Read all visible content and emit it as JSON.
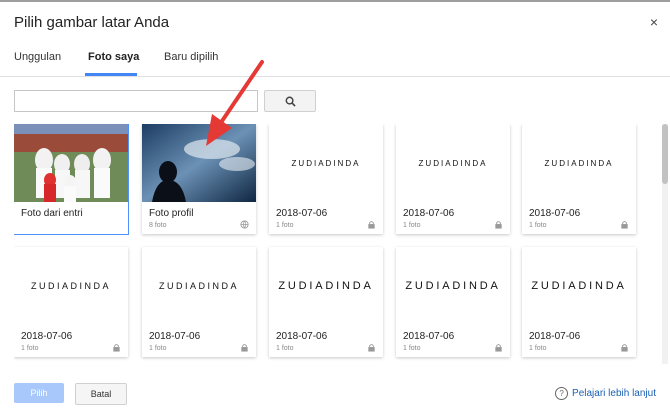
{
  "dialog": {
    "title": "Pilih gambar latar Anda",
    "close_glyph": "×",
    "tabs": [
      {
        "label": "Unggulan",
        "active": false
      },
      {
        "label": "Foto saya",
        "active": true
      },
      {
        "label": "Baru dipilih",
        "active": false
      }
    ],
    "search": {
      "placeholder": "",
      "value": "",
      "button_icon": "search-icon"
    },
    "cards": [
      {
        "title": "Foto dari entri",
        "meta": "",
        "icon": "",
        "image": "group-photo",
        "selected": true
      },
      {
        "title": "Foto profil",
        "meta": "8 foto",
        "icon": "globe-icon",
        "image": "silhouette-sky"
      },
      {
        "title": "2018-07-06",
        "meta": "1 foto",
        "icon": "lock-icon",
        "image": "logo",
        "logo_text": "ZUDIADINDA"
      },
      {
        "title": "2018-07-06",
        "meta": "1 foto",
        "icon": "lock-icon",
        "image": "logo",
        "logo_text": "ZUDIADINDA"
      },
      {
        "title": "2018-07-06",
        "meta": "1 foto",
        "icon": "lock-icon",
        "image": "logo",
        "logo_text": "ZUDIADINDA"
      },
      {
        "title": "2018-07-06",
        "meta": "1 foto",
        "icon": "lock-icon",
        "image": "logo",
        "logo_text": "ZUDIADINDA"
      },
      {
        "title": "2018-07-06",
        "meta": "1 foto",
        "icon": "lock-icon",
        "image": "logo",
        "logo_text": "ZUDIADINDA"
      },
      {
        "title": "2018-07-06",
        "meta": "1 foto",
        "icon": "lock-icon",
        "image": "logo",
        "logo_text": "ZUDIADINDA"
      },
      {
        "title": "2018-07-06",
        "meta": "1 foto",
        "icon": "lock-icon",
        "image": "logo",
        "logo_text": "ZUDIADINDA"
      },
      {
        "title": "2018-07-06",
        "meta": "1 foto",
        "icon": "lock-icon",
        "image": "logo",
        "logo_text": "ZUDIADINDA"
      }
    ],
    "footer": {
      "select_label": "Pilih",
      "cancel_label": "Batal",
      "help_label": "Pelajari lebih lanjut",
      "help_glyph": "?"
    },
    "colors": {
      "accent": "#4285f4",
      "arrow": "#e53935",
      "select_disabled": "#a8c7fa",
      "link": "#1a5fb4"
    }
  }
}
